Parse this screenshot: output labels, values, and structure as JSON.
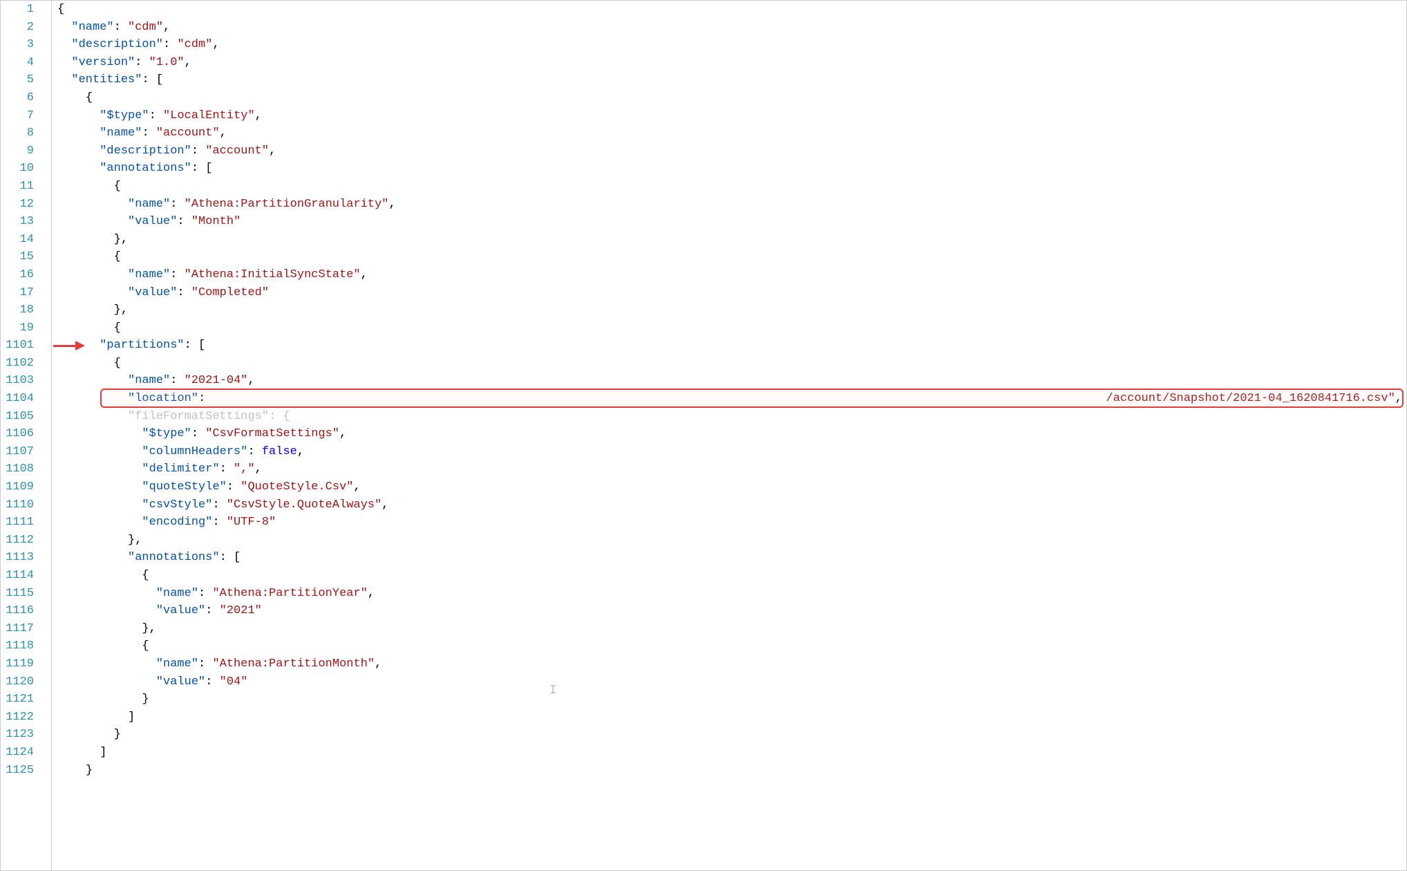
{
  "editor": {
    "lines": [
      {
        "no": "1",
        "indent": 0,
        "tokens": [
          [
            "brace",
            "{"
          ]
        ]
      },
      {
        "no": "2",
        "indent": 1,
        "tokens": [
          [
            "key",
            "\"name\""
          ],
          [
            "punc",
            ": "
          ],
          [
            "string",
            "\"cdm\""
          ],
          [
            "punc",
            ","
          ]
        ]
      },
      {
        "no": "3",
        "indent": 1,
        "tokens": [
          [
            "key",
            "\"description\""
          ],
          [
            "punc",
            ": "
          ],
          [
            "string",
            "\"cdm\""
          ],
          [
            "punc",
            ","
          ]
        ]
      },
      {
        "no": "4",
        "indent": 1,
        "tokens": [
          [
            "key",
            "\"version\""
          ],
          [
            "punc",
            ": "
          ],
          [
            "string",
            "\"1.0\""
          ],
          [
            "punc",
            ","
          ]
        ]
      },
      {
        "no": "5",
        "indent": 1,
        "tokens": [
          [
            "key",
            "\"entities\""
          ],
          [
            "punc",
            ": ["
          ]
        ]
      },
      {
        "no": "6",
        "indent": 2,
        "tokens": [
          [
            "brace",
            "{"
          ]
        ]
      },
      {
        "no": "7",
        "indent": 3,
        "tokens": [
          [
            "key",
            "\"$type\""
          ],
          [
            "punc",
            ": "
          ],
          [
            "string",
            "\"LocalEntity\""
          ],
          [
            "punc",
            ","
          ]
        ]
      },
      {
        "no": "8",
        "indent": 3,
        "tokens": [
          [
            "key",
            "\"name\""
          ],
          [
            "punc",
            ": "
          ],
          [
            "string",
            "\"account\""
          ],
          [
            "punc",
            ","
          ]
        ]
      },
      {
        "no": "9",
        "indent": 3,
        "tokens": [
          [
            "key",
            "\"description\""
          ],
          [
            "punc",
            ": "
          ],
          [
            "string",
            "\"account\""
          ],
          [
            "punc",
            ","
          ]
        ]
      },
      {
        "no": "10",
        "indent": 3,
        "tokens": [
          [
            "key",
            "\"annotations\""
          ],
          [
            "punc",
            ": ["
          ]
        ]
      },
      {
        "no": "11",
        "indent": 4,
        "tokens": [
          [
            "brace",
            "{"
          ]
        ]
      },
      {
        "no": "12",
        "indent": 5,
        "tokens": [
          [
            "key",
            "\"name\""
          ],
          [
            "punc",
            ": "
          ],
          [
            "string",
            "\"Athena:PartitionGranularity\""
          ],
          [
            "punc",
            ","
          ]
        ]
      },
      {
        "no": "13",
        "indent": 5,
        "tokens": [
          [
            "key",
            "\"value\""
          ],
          [
            "punc",
            ": "
          ],
          [
            "string",
            "\"Month\""
          ]
        ]
      },
      {
        "no": "14",
        "indent": 4,
        "tokens": [
          [
            "brace",
            "},"
          ]
        ]
      },
      {
        "no": "15",
        "indent": 4,
        "tokens": [
          [
            "brace",
            "{"
          ]
        ]
      },
      {
        "no": "16",
        "indent": 5,
        "tokens": [
          [
            "key",
            "\"name\""
          ],
          [
            "punc",
            ": "
          ],
          [
            "string",
            "\"Athena:InitialSyncState\""
          ],
          [
            "punc",
            ","
          ]
        ]
      },
      {
        "no": "17",
        "indent": 5,
        "tokens": [
          [
            "key",
            "\"value\""
          ],
          [
            "punc",
            ": "
          ],
          [
            "string",
            "\"Completed\""
          ]
        ]
      },
      {
        "no": "18",
        "indent": 4,
        "tokens": [
          [
            "brace",
            "},"
          ]
        ]
      },
      {
        "no": "19",
        "indent": 4,
        "tokens": [
          [
            "brace",
            "{"
          ]
        ]
      },
      {
        "no": "1101",
        "indent": 3,
        "tokens": [
          [
            "key",
            "\"partitions\""
          ],
          [
            "punc",
            ": ["
          ]
        ]
      },
      {
        "no": "1102",
        "indent": 4,
        "tokens": [
          [
            "brace",
            "{"
          ]
        ]
      },
      {
        "no": "1103",
        "indent": 5,
        "tokens": [
          [
            "key",
            "\"name\""
          ],
          [
            "punc",
            ": "
          ],
          [
            "string",
            "\"2021-04\""
          ],
          [
            "punc",
            ","
          ]
        ]
      },
      {
        "no": "1104",
        "indent": 5,
        "tokens": [
          [
            "key",
            "\"location\""
          ],
          [
            "punc",
            ": "
          ]
        ],
        "highlighted": true,
        "suffix_string": "/account/Snapshot/2021-04_1620841716.csv\"",
        "suffix_punc": ","
      },
      {
        "no": "1105",
        "indent": 5,
        "tokens": [
          [
            "faded",
            "\"fileFormatSettings\": {"
          ]
        ]
      },
      {
        "no": "1106",
        "indent": 6,
        "tokens": [
          [
            "key",
            "\"$type\""
          ],
          [
            "punc",
            ": "
          ],
          [
            "string",
            "\"CsvFormatSettings\""
          ],
          [
            "punc",
            ","
          ]
        ]
      },
      {
        "no": "1107",
        "indent": 6,
        "tokens": [
          [
            "key",
            "\"columnHeaders\""
          ],
          [
            "punc",
            ": "
          ],
          [
            "bool",
            "false"
          ],
          [
            "punc",
            ","
          ]
        ]
      },
      {
        "no": "1108",
        "indent": 6,
        "tokens": [
          [
            "key",
            "\"delimiter\""
          ],
          [
            "punc",
            ": "
          ],
          [
            "string",
            "\",\""
          ],
          [
            "punc",
            ","
          ]
        ]
      },
      {
        "no": "1109",
        "indent": 6,
        "tokens": [
          [
            "key",
            "\"quoteStyle\""
          ],
          [
            "punc",
            ": "
          ],
          [
            "string",
            "\"QuoteStyle.Csv\""
          ],
          [
            "punc",
            ","
          ]
        ]
      },
      {
        "no": "1110",
        "indent": 6,
        "tokens": [
          [
            "key",
            "\"csvStyle\""
          ],
          [
            "punc",
            ": "
          ],
          [
            "string",
            "\"CsvStyle.QuoteAlways\""
          ],
          [
            "punc",
            ","
          ]
        ]
      },
      {
        "no": "1111",
        "indent": 6,
        "tokens": [
          [
            "key",
            "\"encoding\""
          ],
          [
            "punc",
            ": "
          ],
          [
            "string",
            "\"UTF-8\""
          ]
        ]
      },
      {
        "no": "1112",
        "indent": 5,
        "tokens": [
          [
            "brace",
            "},"
          ]
        ]
      },
      {
        "no": "1113",
        "indent": 5,
        "tokens": [
          [
            "key",
            "\"annotations\""
          ],
          [
            "punc",
            ": ["
          ]
        ]
      },
      {
        "no": "1114",
        "indent": 6,
        "tokens": [
          [
            "brace",
            "{"
          ]
        ]
      },
      {
        "no": "1115",
        "indent": 7,
        "tokens": [
          [
            "key",
            "\"name\""
          ],
          [
            "punc",
            ": "
          ],
          [
            "string",
            "\"Athena:PartitionYear\""
          ],
          [
            "punc",
            ","
          ]
        ]
      },
      {
        "no": "1116",
        "indent": 7,
        "tokens": [
          [
            "key",
            "\"value\""
          ],
          [
            "punc",
            ": "
          ],
          [
            "string",
            "\"2021\""
          ]
        ]
      },
      {
        "no": "1117",
        "indent": 6,
        "tokens": [
          [
            "brace",
            "},"
          ]
        ]
      },
      {
        "no": "1118",
        "indent": 6,
        "tokens": [
          [
            "brace",
            "{"
          ]
        ]
      },
      {
        "no": "1119",
        "indent": 7,
        "tokens": [
          [
            "key",
            "\"name\""
          ],
          [
            "punc",
            ": "
          ],
          [
            "string",
            "\"Athena:PartitionMonth\""
          ],
          [
            "punc",
            ","
          ]
        ]
      },
      {
        "no": "1120",
        "indent": 7,
        "tokens": [
          [
            "key",
            "\"value\""
          ],
          [
            "punc",
            ": "
          ],
          [
            "string",
            "\"04\""
          ]
        ]
      },
      {
        "no": "1121",
        "indent": 6,
        "tokens": [
          [
            "brace",
            "}"
          ]
        ]
      },
      {
        "no": "1122",
        "indent": 5,
        "tokens": [
          [
            "brace",
            "]"
          ]
        ]
      },
      {
        "no": "1123",
        "indent": 4,
        "tokens": [
          [
            "brace",
            "}"
          ]
        ]
      },
      {
        "no": "1124",
        "indent": 3,
        "tokens": [
          [
            "brace",
            "]"
          ]
        ]
      },
      {
        "no": "1125",
        "indent": 2,
        "tokens": [
          [
            "brace",
            "}"
          ]
        ]
      }
    ],
    "indentUnit": "  ",
    "annotations": {
      "arrow_target_line": "1101",
      "highlight_line": "1104",
      "caret_line": "1121"
    }
  }
}
